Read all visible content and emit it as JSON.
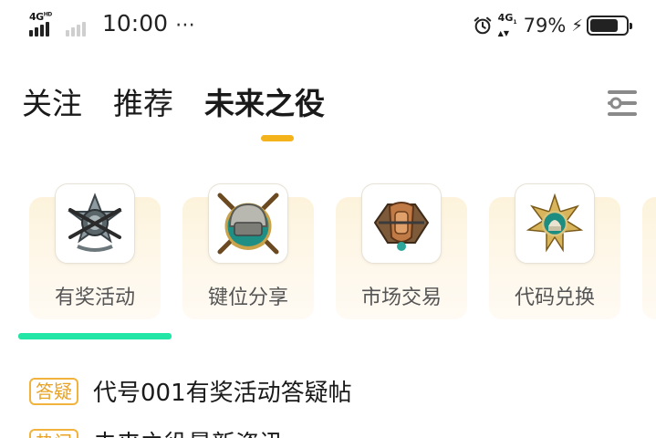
{
  "status_bar": {
    "network_left": "4G",
    "network_left_sup": "HD",
    "time": "10:00",
    "more": "⋯",
    "network_right": "4G",
    "network_right_sub": "1",
    "battery_percent": "79%",
    "battery_level": 0.79
  },
  "tabs": [
    {
      "label": "关注",
      "active": false
    },
    {
      "label": "推荐",
      "active": false
    },
    {
      "label": "未来之役",
      "active": true
    }
  ],
  "accent_color": "#f4b21b",
  "categories": [
    {
      "label": "有奖活动",
      "icon": "crossed-rifles-emblem-icon"
    },
    {
      "label": "键位分享",
      "icon": "helmet-crossed-rifles-emblem-icon"
    },
    {
      "label": "市场交易",
      "icon": "bronze-shield-emblem-icon"
    },
    {
      "label": "代码兑换",
      "icon": "gold-star-emblem-icon"
    }
  ],
  "category_scroll_color": "#21e6a6",
  "posts": [
    {
      "tag": "答疑",
      "title": "代号001有奖活动答疑帖"
    },
    {
      "tag": "热门",
      "title": "未来之役最新资讯"
    }
  ]
}
